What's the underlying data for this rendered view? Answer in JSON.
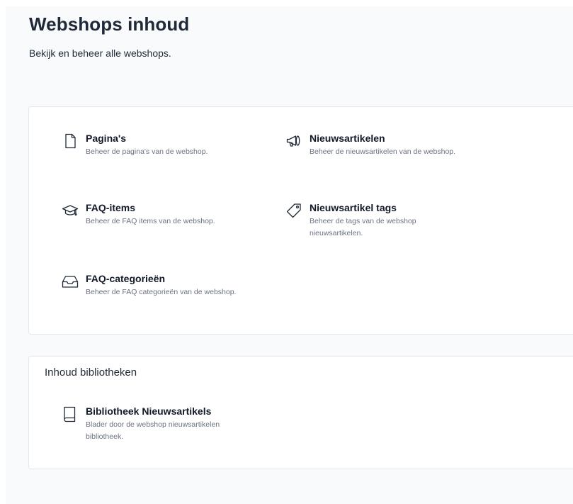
{
  "header": {
    "title": "Webshops inhoud",
    "subtitle": "Bekijk en beheer alle webshops."
  },
  "content_card": {
    "items": [
      {
        "icon": "document-icon",
        "label": "Pagina's",
        "description": "Beheer de pagina's van de webshop."
      },
      {
        "icon": "megaphone-icon",
        "label": "Nieuwsartikelen",
        "description": "Beheer de nieuwsartikelen van de webshop."
      },
      {
        "icon": "graduation-cap-icon",
        "label": "FAQ-items",
        "description": "Beheer de FAQ items van de webshop."
      },
      {
        "icon": "tag-icon",
        "label": "Nieuwsartikel tags",
        "description": "Beheer de tags van de webshop nieuwsartikelen."
      },
      {
        "icon": "inbox-icon",
        "label": "FAQ-categorieën",
        "description": "Beheer de FAQ categorieën van de webshop."
      }
    ]
  },
  "libraries_card": {
    "heading": "Inhoud bibliotheken",
    "items": [
      {
        "icon": "book-icon",
        "label": "Bibliotheek Nieuwsartikels",
        "description": "Blader door de webshop nieuwsartikelen bibliotheek."
      }
    ]
  },
  "colors": {
    "text": "#1f2937",
    "muted": "#6b7280",
    "border": "#e5e7eb",
    "background": "#f9fafb"
  }
}
